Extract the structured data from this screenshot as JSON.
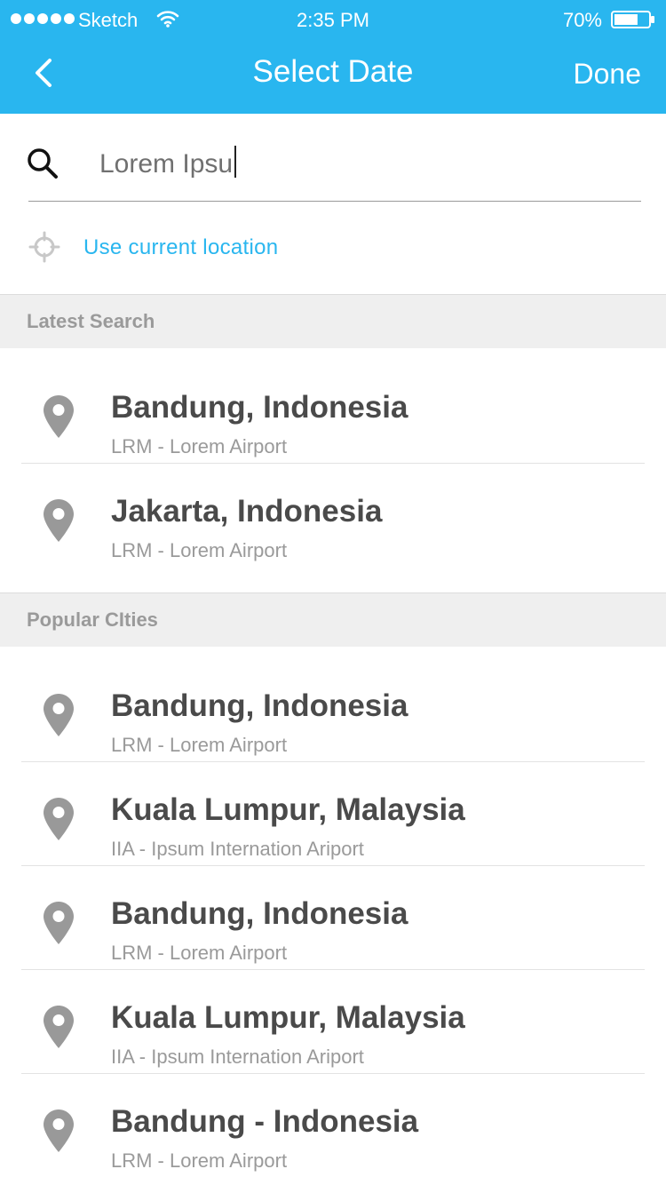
{
  "status_bar": {
    "carrier": "Sketch",
    "time": "2:35 PM",
    "battery": "70%",
    "battery_level": 0.7
  },
  "nav": {
    "title": "Select Date",
    "done_label": "Done",
    "back_icon": "chevron-left-icon"
  },
  "search": {
    "value": "Lorem Ipsu",
    "icon": "search-icon"
  },
  "location": {
    "label": "Use current location",
    "icon": "crosshair-icon"
  },
  "sections": {
    "latest": {
      "title": "Latest Search",
      "items": [
        {
          "title": "Bandung, Indonesia",
          "subtitle": "LRM - Lorem Airport"
        },
        {
          "title": "Jakarta, Indonesia",
          "subtitle": "LRM - Lorem Airport"
        }
      ]
    },
    "popular": {
      "title": "Popular CIties",
      "items": [
        {
          "title": "Bandung, Indonesia",
          "subtitle": "LRM - Lorem Airport"
        },
        {
          "title": "Kuala Lumpur, Malaysia",
          "subtitle": "IIA - Ipsum Internation Ariport"
        },
        {
          "title": "Bandung, Indonesia",
          "subtitle": "LRM - Lorem Airport"
        },
        {
          "title": "Kuala Lumpur, Malaysia",
          "subtitle": "IIA - Ipsum Internation Ariport"
        },
        {
          "title": "Bandung - Indonesia",
          "subtitle": "LRM - Lorem Airport"
        }
      ]
    }
  },
  "colors": {
    "accent": "#29b6ef",
    "title_text": "#4a4a4a",
    "secondary_text": "#9a9a9a",
    "section_bg": "#efefef"
  }
}
